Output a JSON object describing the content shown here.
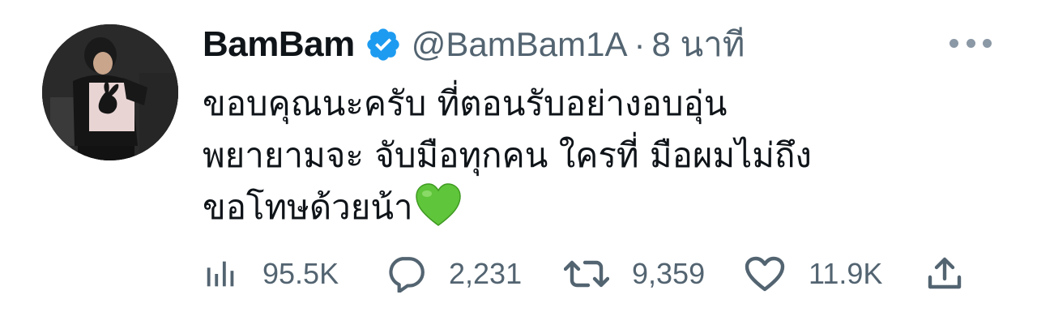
{
  "author": {
    "display_name": "BamBam",
    "handle": "@BamBam1A",
    "separator": "·",
    "time": "8 นาที",
    "verified": true
  },
  "tweet": {
    "lines": [
      "ขอบคุณนะครับ ที่ตอนรับอย่างอบอุ่น",
      "พยายามจะ จับมือทุกคน ใครที่ มือผมไม่ถึง",
      "ขอโทษด้วยน้า"
    ],
    "emoji": "green-heart"
  },
  "actions": {
    "views": "95.5K",
    "replies": "2,231",
    "retweets": "9,359",
    "likes": "11.9K"
  },
  "icons": {
    "views": "views-bar-chart-icon",
    "reply": "reply-bubble-icon",
    "retweet": "retweet-icon",
    "like": "heart-outline-icon",
    "share": "share-upload-icon",
    "more": "more-dots-icon"
  },
  "colors": {
    "verified_blue": "#1d9bf0",
    "secondary_text": "#536471",
    "primary_text": "#0f1419",
    "emoji_green": "#5fc53a"
  }
}
